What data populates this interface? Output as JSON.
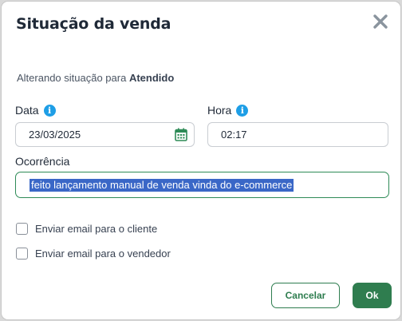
{
  "dialog": {
    "title": "Situação da venda",
    "subtitle_prefix": "Alterando situação para ",
    "subtitle_status": "Atendido"
  },
  "fields": {
    "date_label": "Data",
    "date_value": "23/03/2025",
    "time_label": "Hora",
    "time_value": "02:17",
    "occurrence_label": "Ocorrência",
    "occurrence_value": "feito lançamento manual de venda vinda do e-commerce"
  },
  "options": {
    "email_client": "Enviar email para o cliente",
    "email_seller": "Enviar email para o vendedor"
  },
  "buttons": {
    "cancel": "Cancelar",
    "ok": "Ok"
  },
  "icons": {
    "close": "close-icon",
    "info": "info-icon",
    "calendar": "calendar-icon"
  },
  "colors": {
    "primary": "#2f7d4f",
    "info": "#1e9ee6",
    "selection": "#3a67c7"
  }
}
